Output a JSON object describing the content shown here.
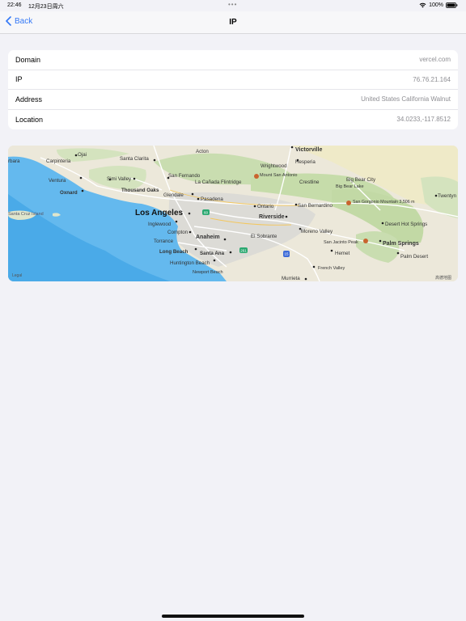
{
  "status_bar": {
    "time": "22:46",
    "date": "12月23日周六",
    "dots": "•••",
    "battery": "100%"
  },
  "nav": {
    "back_label": "Back",
    "title": "IP"
  },
  "info_rows": [
    {
      "label": "Domain",
      "value": "vercel.com"
    },
    {
      "label": "IP",
      "value": "76.76.21.164"
    },
    {
      "label": "Address",
      "value": "United States California Walnut"
    },
    {
      "label": "Location",
      "value": "34.0233,-117.8512"
    }
  ],
  "map": {
    "labels": {
      "los_angeles": "Los Angeles",
      "victorville": "Victorville",
      "hesperia": "Hesperia",
      "santa_clarita": "Santa Clarita",
      "ojai": "Ojai",
      "carpinteria": "Carpinteria",
      "barbara": "rbara",
      "ventura": "Ventura",
      "oxnard": "Oxnard",
      "simi_valley": "Simi Valley",
      "thousand_oaks": "Thousand Oaks",
      "san_fernando": "San Fernando",
      "la_canada": "La Cañada Flintridge",
      "glendale": "Glendale",
      "pasadena": "Pasadena",
      "acton": "Acton",
      "wrightwood": "Wrightwood",
      "mount_san_antonio": "Mount San Antonio",
      "crestline": "Crestline",
      "big_bear_city": "Big Bear City",
      "big_bear_lake": "Big Bear Lake",
      "ontario": "Ontario",
      "san_bernardino": "San Bernardino",
      "san_gorgonio": "San Gorgonio Mountain 3,506 m",
      "twentynine": "Twentyn",
      "riverside": "Riverside",
      "desert_hot_springs": "Desert Hot Springs",
      "santa_cruz_island": "Santa Cruz Island",
      "inglewood": "Inglewood",
      "compton": "Compton",
      "torrance": "Torrance",
      "anaheim": "Anaheim",
      "el_sobrante": "El Sobrante",
      "moreno_valley": "Moreno Valley",
      "san_jacinto_peak": "San Jacinto Peak",
      "palm_springs": "Palm Springs",
      "long_beach": "Long Beach",
      "santa_ana": "Santa Ana",
      "hemet": "Hemet",
      "palm_desert": "Palm Desert",
      "huntington_beach": "Huntington Beach",
      "french_valley": "French Valley",
      "newport_beach": "Newport Beach",
      "murrieta": "Murrieta",
      "legal": "Legal",
      "attribution": "高德地图",
      "shield_60": "60",
      "shield_261": "261",
      "shield_15": "15"
    }
  }
}
